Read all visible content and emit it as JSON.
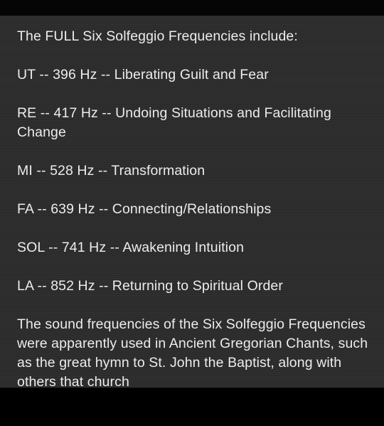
{
  "post": {
    "intro": "The FULL Six Solfeggio Frequencies include:",
    "frequencies": [
      "UT -- 396 Hz -- Liberating Guilt and Fear",
      "RE -- 417 Hz -- Undoing Situations and Facilitating Change",
      "MI -- 528 Hz -- Transformation",
      "FA -- 639 Hz -- Connecting/Relationships",
      "SOL -- 741 Hz -- Awakening Intuition",
      "LA -- 852 Hz -- Returning to Spiritual Order"
    ],
    "paragraph": "The sound frequencies of the Six Solfeggio Frequencies were apparently used in Ancient Gregorian Chants, such as the great hymn to St. John the Baptist, along with others that church"
  },
  "colors": {
    "background": "#2b2b2b",
    "text": "#ececec",
    "frame": "#000000"
  }
}
